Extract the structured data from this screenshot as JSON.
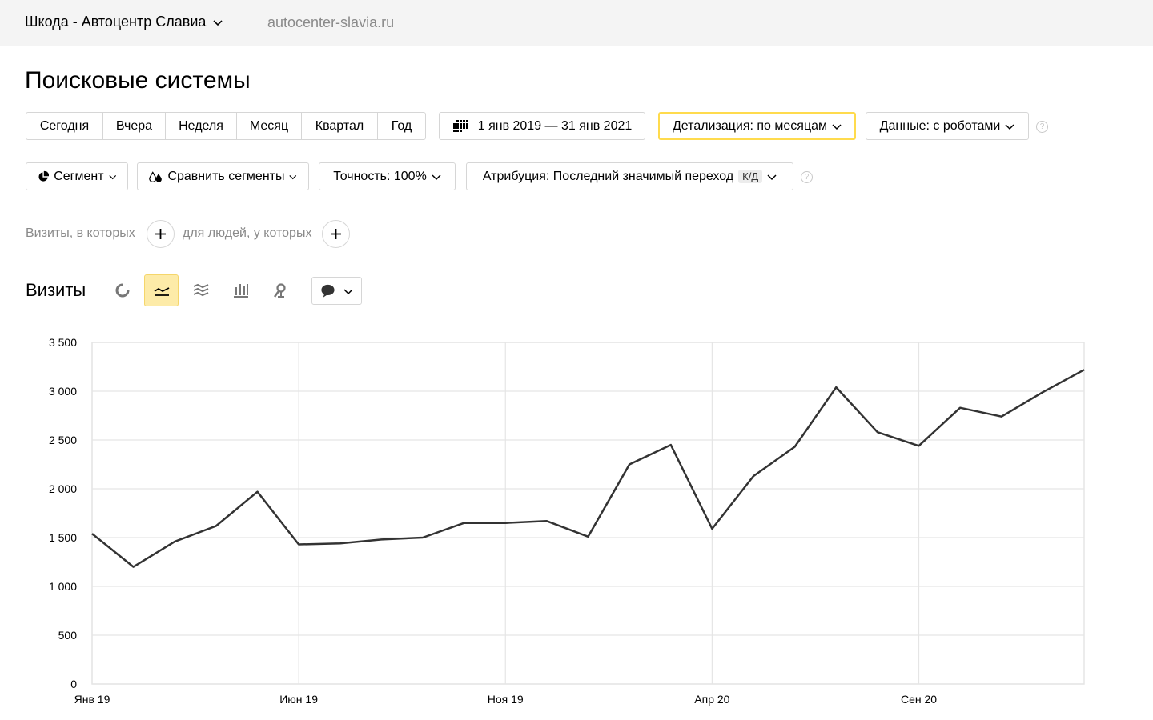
{
  "header": {
    "counter_name": "Шкода - Автоцентр Славиа",
    "site_url": "autocenter-slavia.ru"
  },
  "page": {
    "title": "Поисковые системы"
  },
  "period": {
    "items": [
      "Сегодня",
      "Вчера",
      "Неделя",
      "Месяц",
      "Квартал",
      "Год"
    ],
    "date_range": "1 янв 2019 — 31 янв 2021",
    "detail": "Детализация: по месяцам",
    "data_mode": "Данные: с роботами"
  },
  "filters": {
    "segment": "Сегмент",
    "compare": "Сравнить сегменты",
    "accuracy": "Точность: 100%",
    "attribution": "Атрибуция: Последний значимый переход",
    "attribution_badge": "К/Д"
  },
  "segment_builder": {
    "visits_label": "Визиты, в которых",
    "people_label": "для людей, у которых"
  },
  "chart_section": {
    "title": "Визиты",
    "icons": [
      "pie-chart-icon",
      "line-chart-icon",
      "area-chart-icon",
      "bar-chart-icon",
      "map-icon",
      "comment-icon"
    ],
    "active_view": "line-chart-icon"
  },
  "colors": {
    "accent_yellow": "#ffdb4d",
    "active_bg": "#fdeba8",
    "line": "#333333",
    "grid": "#e5e5e5"
  },
  "chart_data": {
    "type": "line",
    "title": "",
    "xlabel": "",
    "ylabel": "",
    "ylim": [
      0,
      3500
    ],
    "yticks": [
      0,
      500,
      1000,
      1500,
      2000,
      2500,
      3000,
      3500
    ],
    "ytick_labels": [
      "0",
      "500",
      "1 000",
      "1 500",
      "2 000",
      "2 500",
      "3 000",
      "3 500"
    ],
    "x": [
      "2019-01",
      "2019-02",
      "2019-03",
      "2019-04",
      "2019-05",
      "2019-06",
      "2019-07",
      "2019-08",
      "2019-09",
      "2019-10",
      "2019-11",
      "2019-12",
      "2020-01",
      "2020-02",
      "2020-03",
      "2020-04",
      "2020-05",
      "2020-06",
      "2020-07",
      "2020-08",
      "2020-09",
      "2020-10",
      "2020-11",
      "2020-12",
      "2021-01"
    ],
    "xtick_labels": [
      {
        "at": "2019-01",
        "label": "Янв 19"
      },
      {
        "at": "2019-06",
        "label": "Июн 19"
      },
      {
        "at": "2019-11",
        "label": "Ноя 19"
      },
      {
        "at": "2020-04",
        "label": "Апр 20"
      },
      {
        "at": "2020-09",
        "label": "Сен 20"
      }
    ],
    "grid": true,
    "series": [
      {
        "values": [
          1540,
          1200,
          1460,
          1620,
          1970,
          1430,
          1440,
          1480,
          1500,
          1650,
          1650,
          1670,
          1510,
          2250,
          2450,
          1590,
          2130,
          2430,
          3040,
          2580,
          2440,
          2830,
          2740,
          2990,
          3220
        ]
      }
    ]
  }
}
